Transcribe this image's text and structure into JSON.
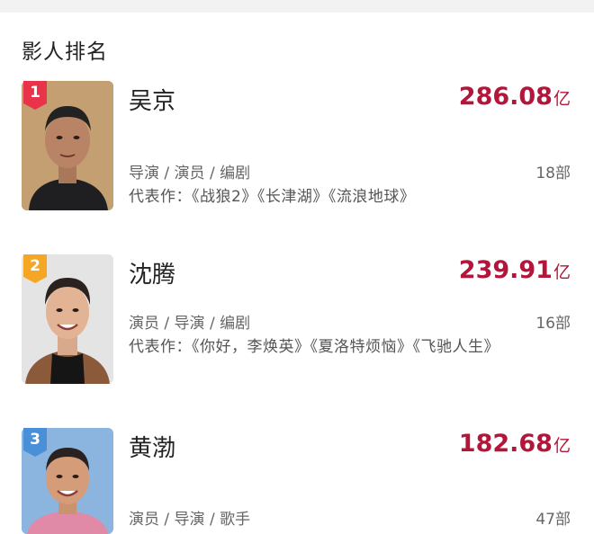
{
  "section": {
    "title": "影人排名"
  },
  "ranking": [
    {
      "rank": "1",
      "rank_color": "#e8334b",
      "name": "吴京",
      "box_value": "286.08",
      "box_unit": "亿",
      "roles": "导演 / 演员 / 编剧",
      "film_count": "18部",
      "works": "代表作：《战狼2》《长津湖》《流浪地球》"
    },
    {
      "rank": "2",
      "rank_color": "#f5a623",
      "name": "沈腾",
      "box_value": "239.91",
      "box_unit": "亿",
      "roles": "演员 / 导演 / 编剧",
      "film_count": "16部",
      "works": "代表作：《你好，李焕英》《夏洛特烦恼》《飞驰人生》"
    },
    {
      "rank": "3",
      "rank_color": "#4a90d9",
      "name": "黄渤",
      "box_value": "182.68",
      "box_unit": "亿",
      "roles": "演员 / 导演 / 歌手",
      "film_count": "47部"
    }
  ],
  "colors": {
    "accent": "#b3163a",
    "text": "#222222",
    "muted": "#666666"
  }
}
